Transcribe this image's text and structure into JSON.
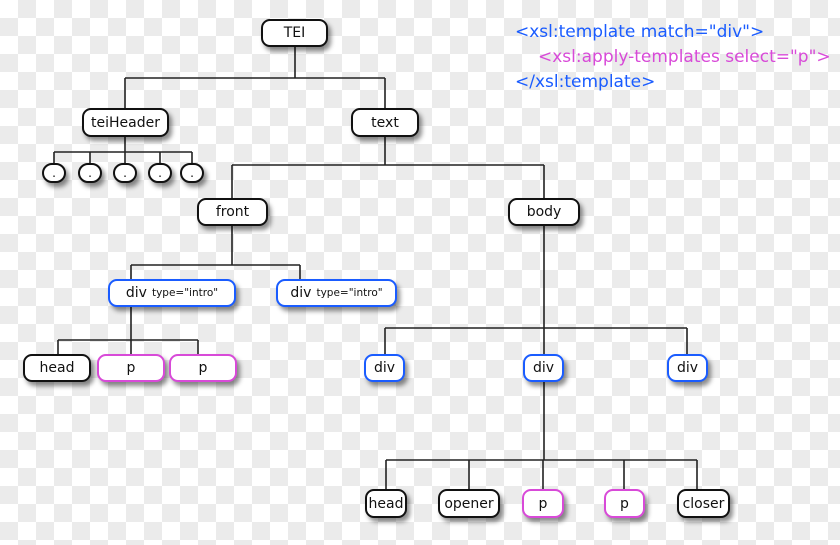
{
  "colors": {
    "element": "#111111",
    "div": "#1a5cff",
    "p": "#d84ad8"
  },
  "code": {
    "line1": "<xsl:template match=\"div\">",
    "line2": "<xsl:apply-templates select=\"p\">",
    "line3": "</xsl:template>"
  },
  "nodes": {
    "tei": "TEI",
    "teiHeader": "teiHeader",
    "text": "text",
    "dot": ".",
    "front": "front",
    "body": "body",
    "div_intro": "div",
    "type_intro": "type=\"intro\"",
    "head": "head",
    "p": "p",
    "div": "div",
    "opener": "opener",
    "closer": "closer"
  }
}
